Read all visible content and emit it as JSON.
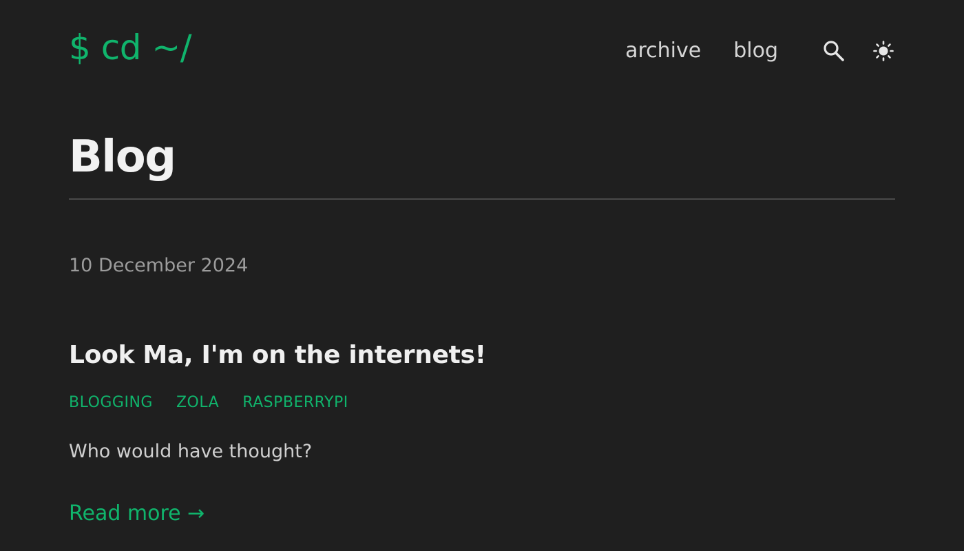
{
  "header": {
    "logo_text": "$ cd ~/",
    "nav": [
      {
        "label": "archive"
      },
      {
        "label": "blog"
      }
    ],
    "search_icon": "search-icon",
    "theme_icon": "sun-icon"
  },
  "main": {
    "title": "Blog",
    "posts": [
      {
        "date": "10 December 2024",
        "title": "Look Ma, I'm on the internets!",
        "tags": [
          "BLOGGING",
          "ZOLA",
          "RASPBERRYPI"
        ],
        "summary": "Who would have thought?",
        "read_more": "Read more →"
      }
    ]
  },
  "colors": {
    "background": "#1f1f1f",
    "accent": "#10b46c",
    "text": "#f0f0f0",
    "muted": "#9c9c9c"
  }
}
